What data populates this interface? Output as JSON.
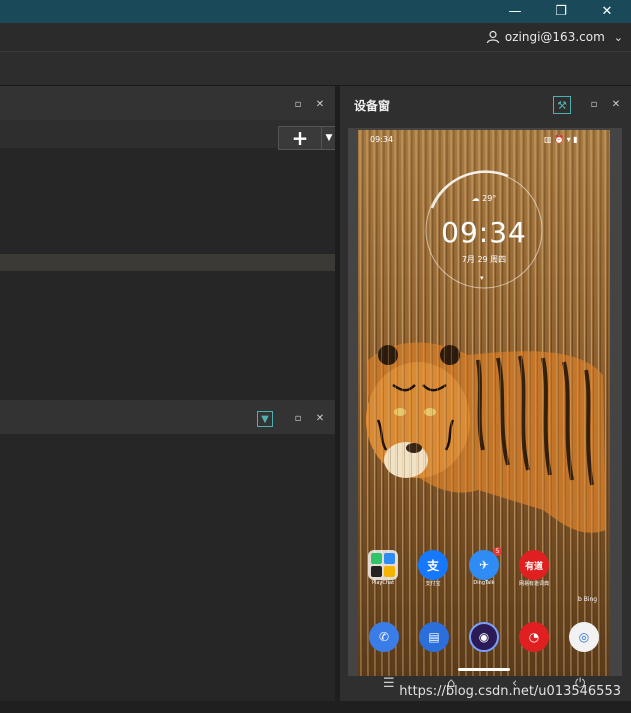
{
  "window": {
    "minimize_glyph": "—",
    "maximize_glyph": "❐",
    "close_glyph": "✕"
  },
  "account": {
    "email": "ozingi@163.com",
    "icon": "user-icon",
    "dropdown_glyph": "⌄"
  },
  "panels": {
    "restore_glyph": "▫",
    "close_glyph": "✕",
    "add_glyph": "+",
    "add_dropdown_glyph": "▼",
    "filter_icon": "filter-icon",
    "filter_glyph": "▼"
  },
  "device_window": {
    "title": "设备窗",
    "tools_icon": "tools-icon",
    "tools_glyph": "⚒"
  },
  "phone": {
    "status_time": "09:34",
    "status_icons": "▥ ⏰ ▾ ▮",
    "weather": "☁ 29°",
    "clock_time": "09:34",
    "date": "7月 29 周四",
    "swipe_hint": "▾",
    "bing": "b Bing",
    "apps_row1": [
      {
        "name": "folder-app",
        "label": "PlayChat",
        "color": "#ffffff",
        "glyph": ""
      },
      {
        "name": "alipay-app",
        "label": "支付宝",
        "color": "#1677ff",
        "glyph": "支"
      },
      {
        "name": "dingtalk-app",
        "label": "DingTalk",
        "color": "#2f8cf4",
        "glyph": "✈",
        "badge": "5"
      },
      {
        "name": "youdao-app",
        "label": "网易有道词典",
        "color": "#e02020",
        "glyph": "有道"
      }
    ],
    "dock": [
      {
        "name": "phone-app",
        "color": "#3b7de8",
        "glyph": "✆"
      },
      {
        "name": "messages-app",
        "color": "#2a6fdb",
        "glyph": "▤"
      },
      {
        "name": "browser-app",
        "color": "#2a1a55",
        "glyph": "◉"
      },
      {
        "name": "music-app",
        "color": "#e02020",
        "glyph": "◔"
      },
      {
        "name": "camera-app",
        "color": "#f2f2f2",
        "glyph": "◎"
      }
    ]
  },
  "nav": {
    "menu": "☰",
    "home": "⌂",
    "back": "‹",
    "power": "⏻"
  },
  "watermark": "https://blog.csdn.net/u013546553"
}
